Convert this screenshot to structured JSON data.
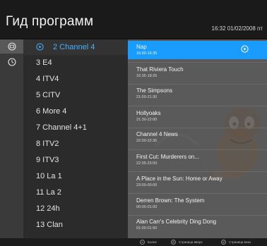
{
  "header": {
    "title": "Гид программ",
    "datetime": "16:32 01/02/2008 пт"
  },
  "rail": {
    "items": [
      {
        "icon": "tv-icon",
        "active": true
      },
      {
        "icon": "clock-icon",
        "active": false
      }
    ]
  },
  "channels": [
    {
      "label": "2 Channel 4",
      "selected": true
    },
    {
      "label": "3 E4"
    },
    {
      "label": "4 ITV4"
    },
    {
      "label": "5 CITV"
    },
    {
      "label": "6 More 4"
    },
    {
      "label": "7 Channel 4+1"
    },
    {
      "label": "8 ITV2"
    },
    {
      "label": "9 ITV3"
    },
    {
      "label": "10 La 1"
    },
    {
      "label": "11 La 2"
    },
    {
      "label": "12 24h"
    },
    {
      "label": "13 Clan"
    }
  ],
  "programs": [
    {
      "title": "Nap",
      "time": "16:30-16:35",
      "selected": true
    },
    {
      "title": "That Riviera Touch",
      "time": "16:35-18:25"
    },
    {
      "title": "The Simpsons",
      "time": "21:00-21:30"
    },
    {
      "title": "Hollyoaks",
      "time": "21:30-22:00"
    },
    {
      "title": "Channel 4 News",
      "time": "22:00-22:35"
    },
    {
      "title": "First Cut: Murderers on...",
      "time": "22:35-23:00"
    },
    {
      "title": "A Place in the Sun: Home or Away",
      "time": "23:00-00:00"
    },
    {
      "title": "Derren Brown: The System",
      "time": "00:00-01:00"
    },
    {
      "title": "Alan Carr's Celebrity Ding Dong",
      "time": "01:00-01:50"
    }
  ],
  "footer": {
    "more": "Более",
    "page_up": "Страница вверх",
    "page_down": "Страница вниз"
  },
  "colors": {
    "accent": "#1a9cff",
    "selected_channel_text": "#49b1ff"
  }
}
